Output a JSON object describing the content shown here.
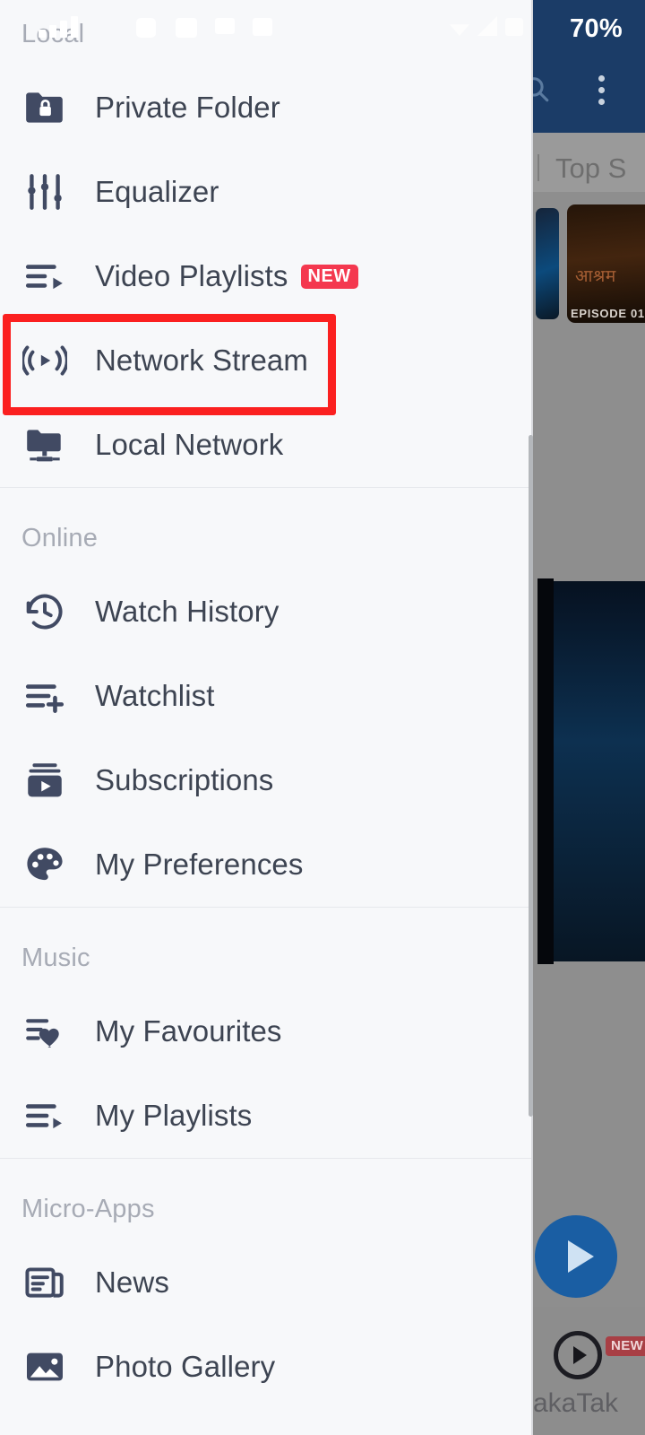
{
  "status_bar": {
    "battery_percent": "70%"
  },
  "background_app": {
    "tab_label": "Top S",
    "thumbnail_title": "आश्रम",
    "thumbnail_episode": "EPISODE 01",
    "moj_label": "akaTak",
    "moj_badge": "NEW",
    "header_color": "#1b3c67",
    "fab_color": "#1a5ea3",
    "search_icon": "search-icon",
    "overflow_icon": "kebab-menu-icon",
    "fab_icon": "play-icon"
  },
  "drawer": {
    "background_color": "#f7f8fa",
    "text_color": "#3d4452",
    "section_label_color": "#a7abb5",
    "icon_color": "#414a63",
    "sections": [
      {
        "title": "Local",
        "items": [
          {
            "label": "Private Folder",
            "icon": "private-folder-icon",
            "badge": null
          },
          {
            "label": "Equalizer",
            "icon": "equalizer-icon",
            "badge": null
          },
          {
            "label": "Video Playlists",
            "icon": "video-playlist-icon",
            "badge": "NEW"
          },
          {
            "label": "Network Stream",
            "icon": "network-stream-icon",
            "badge": null
          },
          {
            "label": "Local Network",
            "icon": "local-network-icon",
            "badge": null
          }
        ]
      },
      {
        "title": "Online",
        "items": [
          {
            "label": "Watch History",
            "icon": "history-icon",
            "badge": null
          },
          {
            "label": "Watchlist",
            "icon": "watchlist-add-icon",
            "badge": null
          },
          {
            "label": "Subscriptions",
            "icon": "subscriptions-icon",
            "badge": null
          },
          {
            "label": "My Preferences",
            "icon": "palette-icon",
            "badge": null
          }
        ]
      },
      {
        "title": "Music",
        "items": [
          {
            "label": "My Favourites",
            "icon": "favourites-heart-icon",
            "badge": null
          },
          {
            "label": "My Playlists",
            "icon": "playlist-play-icon",
            "badge": null
          }
        ]
      },
      {
        "title": "Micro-Apps",
        "items": [
          {
            "label": "News",
            "icon": "news-icon",
            "badge": null
          },
          {
            "label": "Photo Gallery",
            "icon": "photo-gallery-icon",
            "badge": null
          }
        ]
      }
    ]
  },
  "highlight": {
    "target": "Network Stream",
    "color": "#fb2020"
  }
}
